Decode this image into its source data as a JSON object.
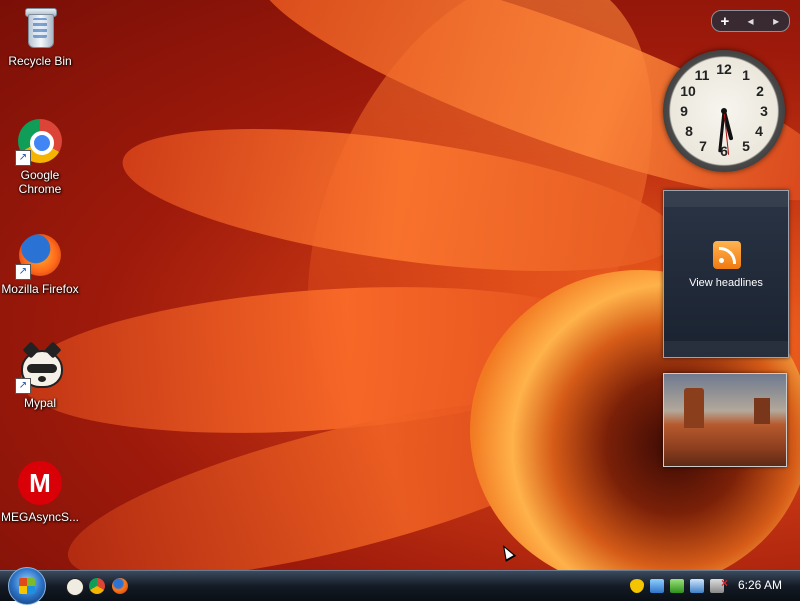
{
  "desktop": {
    "icons": [
      {
        "label": "Recycle Bin",
        "icon": "recycle-bin-icon"
      },
      {
        "label": "Google Chrome",
        "icon": "chrome-icon"
      },
      {
        "label": "Mozilla Firefox",
        "icon": "firefox-icon"
      },
      {
        "label": "Mypal",
        "icon": "mypal-raccoon-icon"
      },
      {
        "label": "MEGAsyncS...",
        "icon": "mega-icon"
      }
    ],
    "mega_letter": "M"
  },
  "sidebar": {
    "add_label": "+",
    "prev_label": "◂",
    "next_label": "▸",
    "clock": {
      "hour": 5,
      "minute": 31,
      "second": 29
    },
    "feed": {
      "label": "View headlines",
      "icon": "rss-icon"
    },
    "slideshow": {
      "icon": "desert-butte-photo"
    }
  },
  "taskbar": {
    "start_icon": "windows-start-orb",
    "quick_launch": [
      "mypal-icon",
      "chrome-icon",
      "firefox-icon"
    ],
    "tray_icons": [
      "security-shield-icon",
      "network-icon",
      "update-icon",
      "computer-icon",
      "muted-speaker-icon"
    ],
    "time": "6:26 AM"
  }
}
